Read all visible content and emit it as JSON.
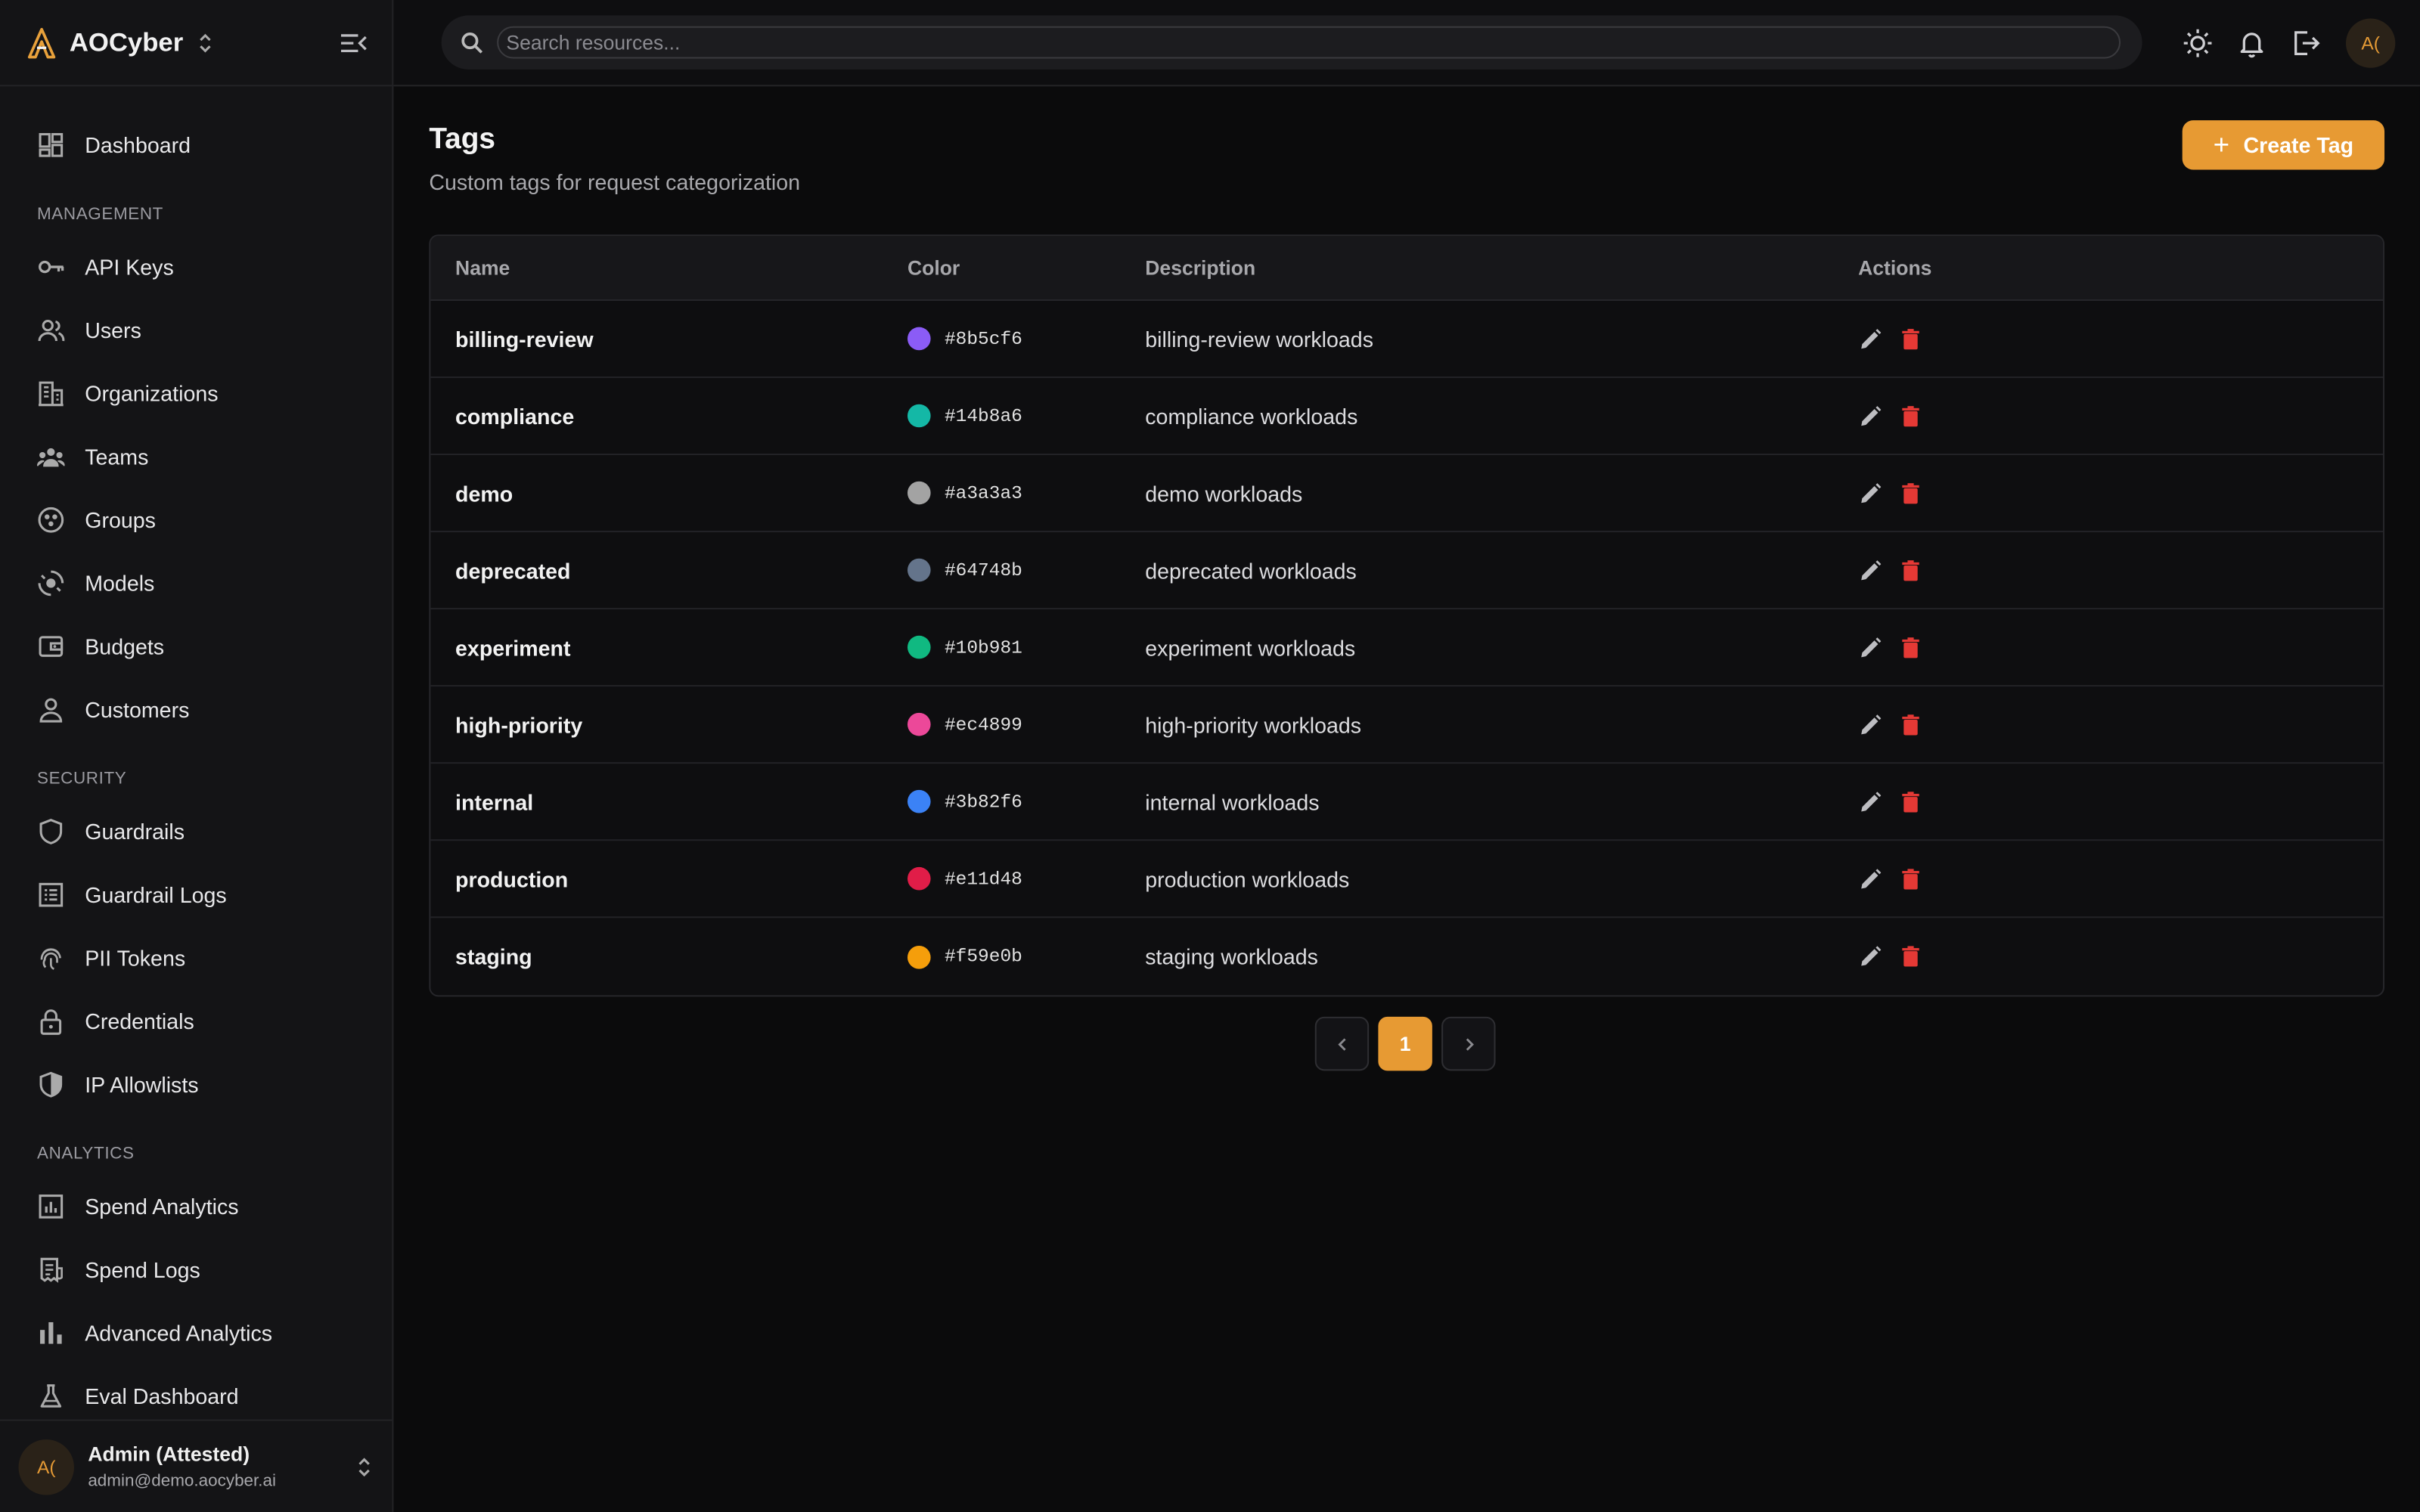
{
  "brand": {
    "name": "AOCyber"
  },
  "sidebar": {
    "top_items": [
      {
        "label": "Dashboard",
        "icon": "dashboard-icon"
      }
    ],
    "sections": [
      {
        "title": "MANAGEMENT",
        "items": [
          {
            "label": "API Keys",
            "icon": "key-icon"
          },
          {
            "label": "Users",
            "icon": "users-icon"
          },
          {
            "label": "Organizations",
            "icon": "building-icon"
          },
          {
            "label": "Teams",
            "icon": "team-icon"
          },
          {
            "label": "Groups",
            "icon": "groups-icon"
          },
          {
            "label": "Models",
            "icon": "model-icon"
          },
          {
            "label": "Budgets",
            "icon": "wallet-icon"
          },
          {
            "label": "Customers",
            "icon": "person-icon"
          }
        ]
      },
      {
        "title": "SECURITY",
        "items": [
          {
            "label": "Guardrails",
            "icon": "shield-icon"
          },
          {
            "label": "Guardrail Logs",
            "icon": "log-list-icon"
          },
          {
            "label": "PII Tokens",
            "icon": "fingerprint-icon"
          },
          {
            "label": "Credentials",
            "icon": "lock-icon"
          },
          {
            "label": "IP Allowlists",
            "icon": "shield-half-icon"
          }
        ]
      },
      {
        "title": "ANALYTICS",
        "items": [
          {
            "label": "Spend Analytics",
            "icon": "analytics-icon"
          },
          {
            "label": "Spend Logs",
            "icon": "receipt-icon"
          },
          {
            "label": "Advanced Analytics",
            "icon": "bar-chart-icon"
          },
          {
            "label": "Eval Dashboard",
            "icon": "flask-icon"
          }
        ]
      }
    ]
  },
  "user": {
    "initials": "A(",
    "name": "Admin (Attested)",
    "email": "admin@demo.aocyber.ai"
  },
  "topbar": {
    "search_placeholder": "Search resources...",
    "avatar_initials": "A("
  },
  "page": {
    "title": "Tags",
    "subtitle": "Custom tags for request categorization",
    "create_label": "Create Tag"
  },
  "table": {
    "headers": {
      "name": "Name",
      "color": "Color",
      "description": "Description",
      "actions": "Actions"
    },
    "rows": [
      {
        "name": "billing-review",
        "color": "#8b5cf6",
        "description": "billing-review workloads"
      },
      {
        "name": "compliance",
        "color": "#14b8a6",
        "description": "compliance workloads"
      },
      {
        "name": "demo",
        "color": "#a3a3a3",
        "description": "demo workloads"
      },
      {
        "name": "deprecated",
        "color": "#64748b",
        "description": "deprecated workloads"
      },
      {
        "name": "experiment",
        "color": "#10b981",
        "description": "experiment workloads"
      },
      {
        "name": "high-priority",
        "color": "#ec4899",
        "description": "high-priority workloads"
      },
      {
        "name": "internal",
        "color": "#3b82f6",
        "description": "internal workloads"
      },
      {
        "name": "production",
        "color": "#e11d48",
        "description": "production workloads"
      },
      {
        "name": "staging",
        "color": "#f59e0b",
        "description": "staging workloads"
      }
    ]
  },
  "pagination": {
    "current": "1"
  },
  "colors": {
    "accent": "#e79a33",
    "delete": "#e53935"
  }
}
